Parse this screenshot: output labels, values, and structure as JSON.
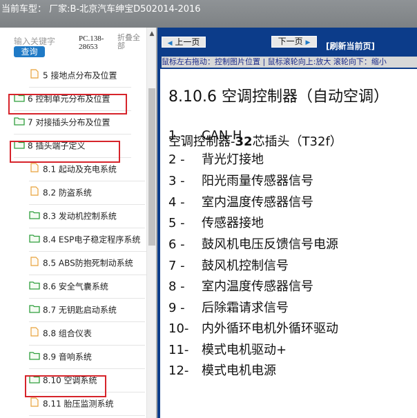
{
  "window": {
    "title": "当前车型：  厂家:B-北京汽车绅宝D502014-2016"
  },
  "sidebar": {
    "keyword_placeholder": "输入关键字",
    "search_label": "查询",
    "pc_code": "PC.138-28653",
    "collapse_all": "折叠全部",
    "items": [
      {
        "label": "5  接地点分布及位置",
        "icon": "page-icon"
      },
      {
        "label": "6  控制单元分布及位置",
        "icon": "folder-icon"
      },
      {
        "label": "7  对接插头分布及位置",
        "icon": "folder-icon"
      },
      {
        "label": "8  插头端子定义",
        "icon": "folder-icon"
      },
      {
        "label": "8.1  起动及充电系统",
        "icon": "page-icon"
      },
      {
        "label": "8.2  防盗系统",
        "icon": "page-icon"
      },
      {
        "label": "8.3  发动机控制系统",
        "icon": "folder-icon"
      },
      {
        "label": "8.4  ESP电子稳定程序系统",
        "icon": "folder-icon"
      },
      {
        "label": "8.5  ABS防抱死制动系统",
        "icon": "page-icon"
      },
      {
        "label": "8.6  安全气囊系统",
        "icon": "folder-icon"
      },
      {
        "label": "8.7  无钥匙启动系统",
        "icon": "folder-icon"
      },
      {
        "label": "8.8  组合仪表",
        "icon": "page-icon"
      },
      {
        "label": "8.9  音响系统",
        "icon": "folder-icon"
      },
      {
        "label": "8.10  空调系统",
        "icon": "folder-icon"
      },
      {
        "label": "8.11  胎压监测系统",
        "icon": "page-icon"
      }
    ]
  },
  "toolbar": {
    "prev_label": "上一页",
    "next_label": "下一页",
    "refresh_label": "[刷新当前页]",
    "hint": "鼠标左右拖动：控制图片位置 | 鼠标滚轮向上:放大   滚轮向下：缩小"
  },
  "document": {
    "heading": "8.10.6 空调控制器（自动空调）",
    "subheading_prefix": "空调控制器-",
    "subheading_bold": "32",
    "subheading_suffix": "芯插头（T32f）",
    "pins": [
      {
        "num": "1 -",
        "desc": "CAN-H"
      },
      {
        "num": "2 -",
        "desc": "背光灯接地"
      },
      {
        "num": "3 -",
        "desc": "阳光雨量传感器信号"
      },
      {
        "num": "4 -",
        "desc": "室内温度传感器信号"
      },
      {
        "num": "5 -",
        "desc": "传感器接地"
      },
      {
        "num": "6 -",
        "desc": "鼓风机电压反馈信号电源"
      },
      {
        "num": "7 -",
        "desc": "鼓风机控制信号"
      },
      {
        "num": "8 -",
        "desc": "室内温度传感器信号"
      },
      {
        "num": "9 -",
        "desc": "后除霜请求信号"
      },
      {
        "num": "10-",
        "desc": "内外循环电机外循环驱动"
      },
      {
        "num": "11-",
        "desc": "模式电机驱动+"
      },
      {
        "num": "12-",
        "desc": "模式电机电源"
      }
    ]
  },
  "colors": {
    "accent_blue": "#1f7ac6",
    "highlight_red": "#d6232a",
    "folder_green": "#2e9e3c",
    "page_orange": "#e8a23c",
    "right_pane_bg": "#0c3c8a"
  }
}
